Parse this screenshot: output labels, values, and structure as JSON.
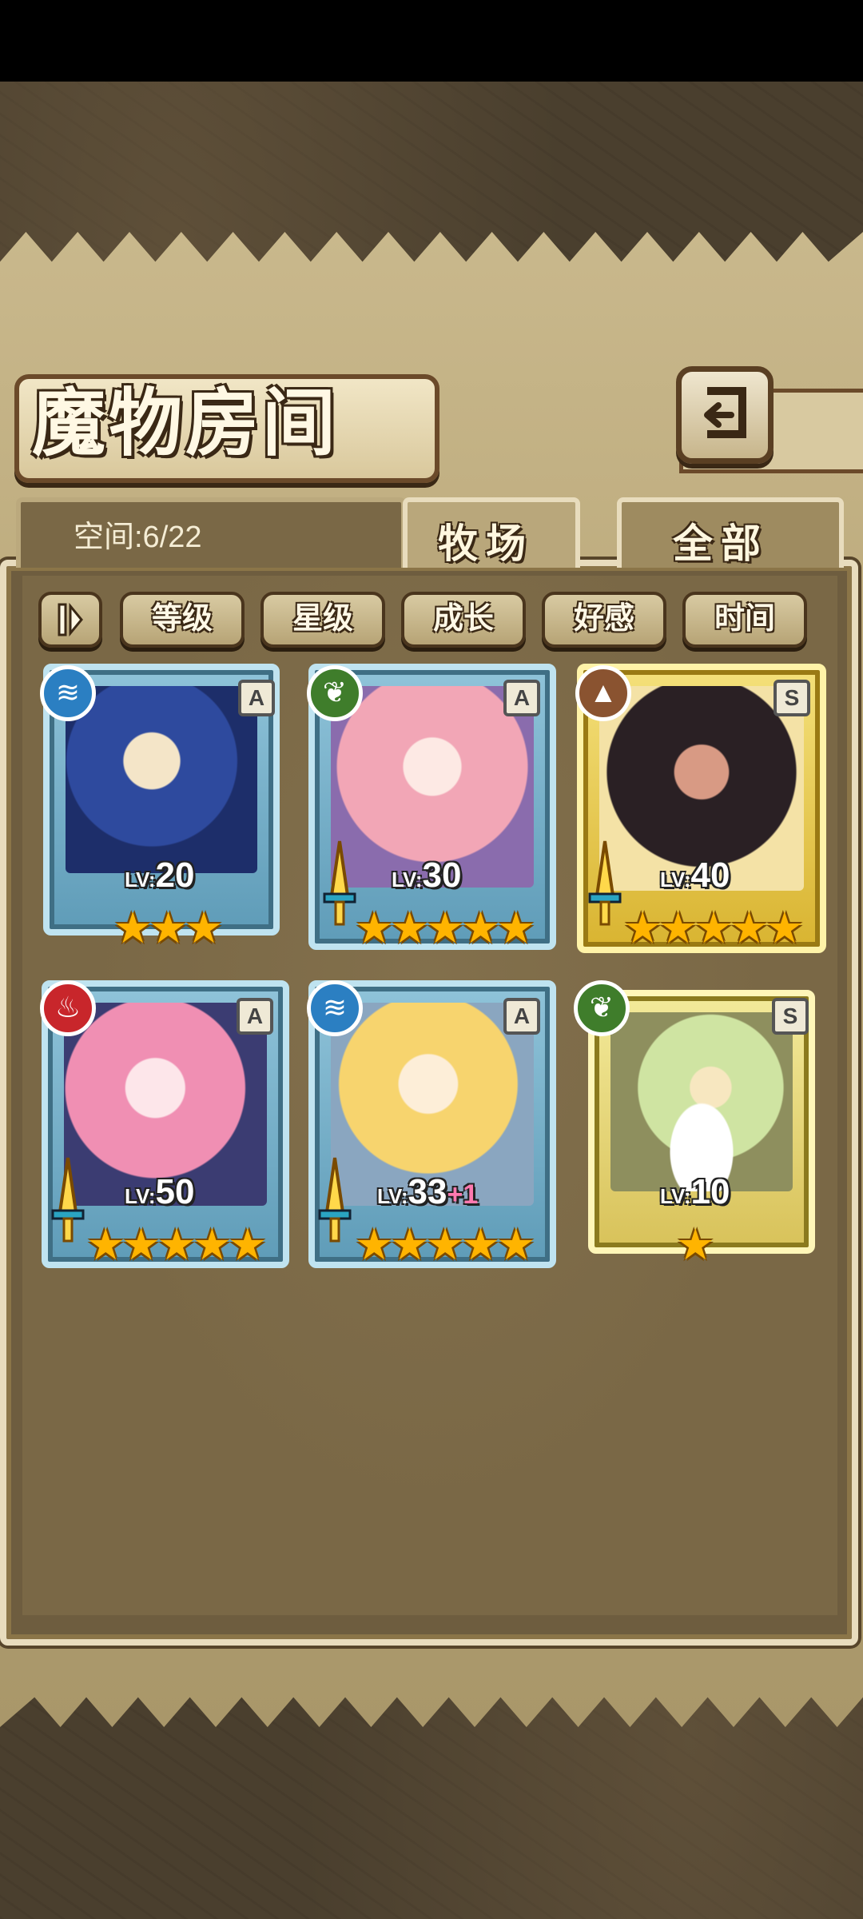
{
  "header": {
    "title": "魔物房间"
  },
  "tabs": {
    "space_label": "空间:6/22",
    "ranch": "牧场",
    "all": "全部"
  },
  "filters": {
    "toggle_icon": "pause-bars-icon",
    "level": "等级",
    "star": "星级",
    "growth": "成长",
    "affection": "好感",
    "time": "时间"
  },
  "monsters": [
    {
      "level_prefix": "LV:",
      "level": "20",
      "bonus": "",
      "rank": "A",
      "element": "water",
      "stars": "★★★",
      "element_color": "#2b7fc2"
    },
    {
      "level_prefix": "LV:",
      "level": "30",
      "bonus": "",
      "rank": "A",
      "element": "wood",
      "stars": "★★★★★",
      "element_color": "#3f7d2b"
    },
    {
      "level_prefix": "LV:",
      "level": "40",
      "bonus": "",
      "rank": "S",
      "element": "earth",
      "stars": "★★★★★",
      "element_color": "#8a5330"
    },
    {
      "level_prefix": "LV:",
      "level": "50",
      "bonus": "",
      "rank": "A",
      "element": "fire",
      "stars": "★★★★★",
      "element_color": "#c8262b"
    },
    {
      "level_prefix": "LV:",
      "level": "33",
      "bonus": "+1",
      "rank": "A",
      "element": "water",
      "stars": "★★★★★",
      "element_color": "#2b7fc2"
    },
    {
      "level_prefix": "LV:",
      "level": "10",
      "bonus": "",
      "rank": "S",
      "element": "wood",
      "stars": "★",
      "element_color": "#3f7d2b"
    }
  ]
}
